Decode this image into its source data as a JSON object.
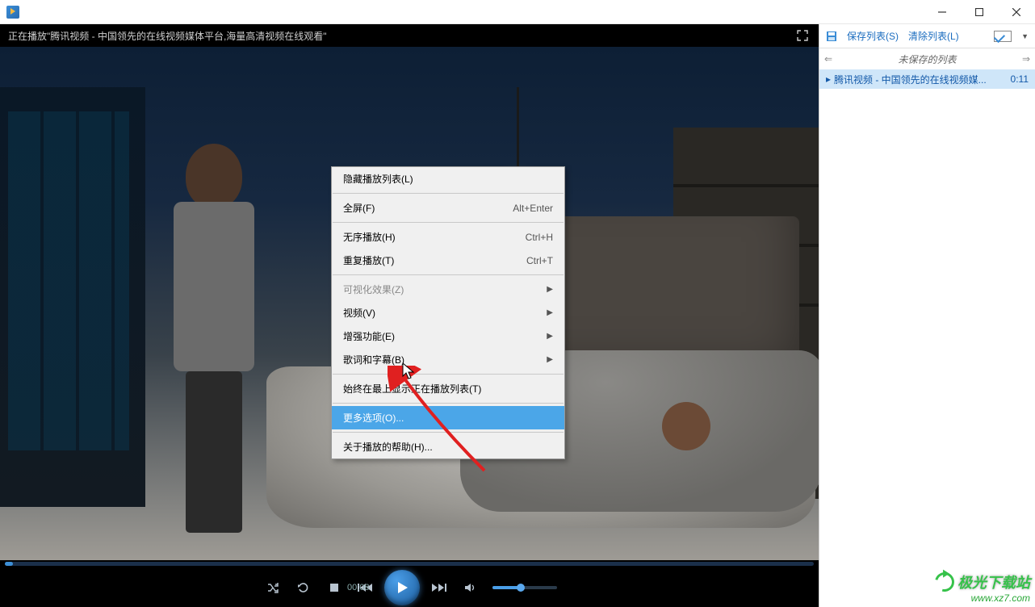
{
  "window": {
    "minimize": "—",
    "maximize": "☐",
    "close": "✕"
  },
  "now_playing": {
    "prefix": "正在播放",
    "title": "\"腾讯视频 - 中国领先的在线视频媒体平台,海量高清视频在线观看\""
  },
  "context_menu": {
    "hide_playlist": "隐藏播放列表(L)",
    "fullscreen": "全屏(F)",
    "fullscreen_sc": "Alt+Enter",
    "shuffle": "无序播放(H)",
    "shuffle_sc": "Ctrl+H",
    "repeat": "重复播放(T)",
    "repeat_sc": "Ctrl+T",
    "visual": "可视化效果(Z)",
    "video": "视频(V)",
    "enhance": "增强功能(E)",
    "lyrics": "歌词和字幕(B)",
    "always_top": "始终在最上显示正在播放列表(T)",
    "more_options": "更多选项(O)...",
    "about_help": "关于播放的帮助(H)..."
  },
  "playback": {
    "current_time": "00:08"
  },
  "playlist": {
    "toolbar": {
      "save_list": "保存列表(S)",
      "clear_list": "清除列表(L)"
    },
    "nav": {
      "prev": "⇐",
      "title": "未保存的列表",
      "next": "⇒"
    },
    "items": [
      {
        "marker": "▸",
        "name": "腾讯视频 - 中国领先的在线视频媒...",
        "duration": "0:11"
      }
    ]
  },
  "watermark": {
    "brand": "极光下载站",
    "url": "www.xz7.com"
  }
}
